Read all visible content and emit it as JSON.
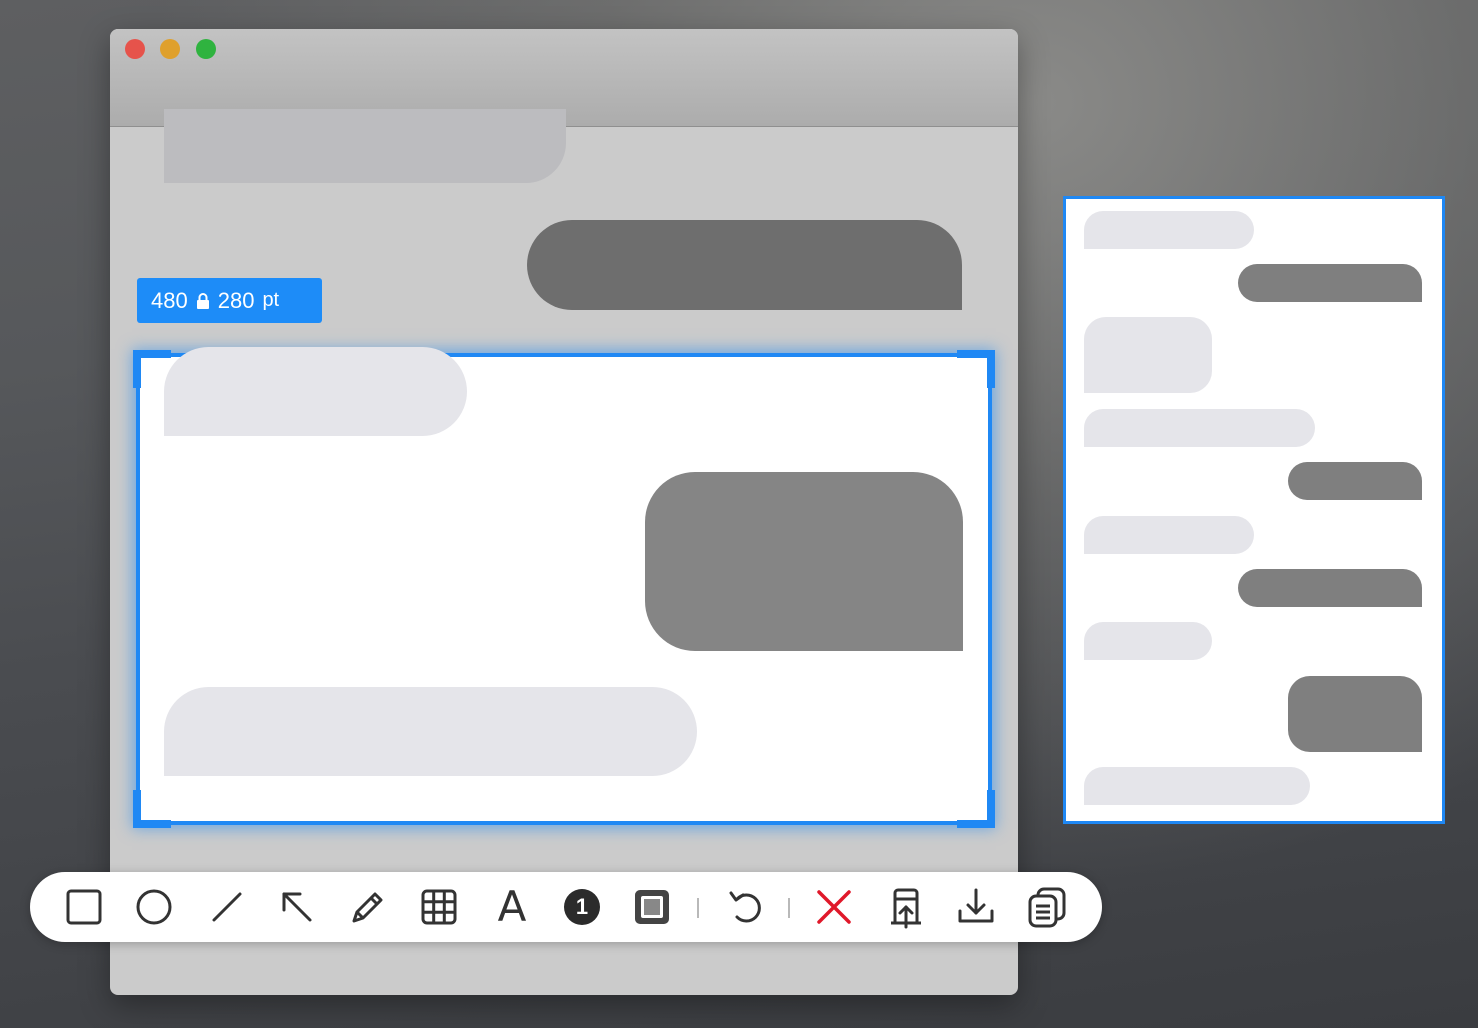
{
  "window": {
    "traffic_lights": [
      "close-button",
      "minimize-button",
      "zoom-button"
    ],
    "colors": {
      "close": "#e6534b",
      "minimize": "#dfa02c",
      "zoom": "#2fb33f"
    }
  },
  "size_badge": {
    "width": "480",
    "height": "280",
    "unit": "pt",
    "lock_icon": "lock-icon"
  },
  "selection": {
    "accent_color": "#1f88f4"
  },
  "toolbar": {
    "tools": [
      {
        "name": "rectangle-tool",
        "icon": "square-icon"
      },
      {
        "name": "ellipse-tool",
        "icon": "circle-icon"
      },
      {
        "name": "line-tool",
        "icon": "line-icon"
      },
      {
        "name": "arrow-tool",
        "icon": "arrow-icon"
      },
      {
        "name": "pencil-tool",
        "icon": "pencil-icon"
      },
      {
        "name": "mosaic-tool",
        "icon": "grid-icon"
      },
      {
        "name": "text-tool",
        "icon": "text-icon",
        "label": "A"
      },
      {
        "name": "counter-tool",
        "icon": "number-badge-icon",
        "label": "1"
      },
      {
        "name": "highlight-tool",
        "icon": "framed-square-icon"
      },
      {
        "name": "undo-button",
        "icon": "undo-icon"
      },
      {
        "name": "cancel-button",
        "icon": "close-icon",
        "color": "#e0182a"
      },
      {
        "name": "pin-button",
        "icon": "pin-upload-icon"
      },
      {
        "name": "save-button",
        "icon": "download-icon"
      },
      {
        "name": "copy-button",
        "icon": "copy-icon"
      }
    ]
  }
}
